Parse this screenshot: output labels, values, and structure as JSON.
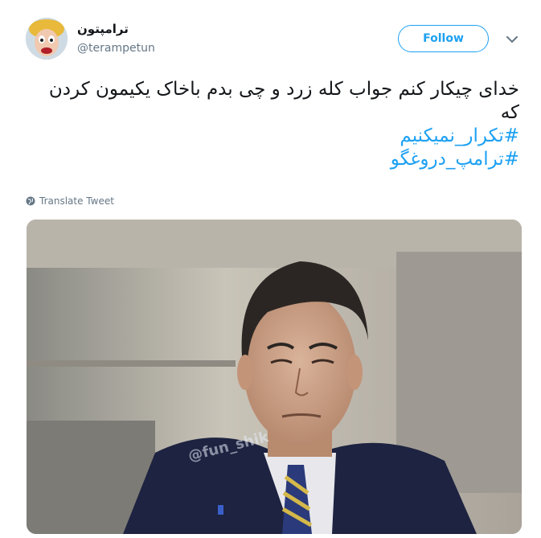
{
  "author": {
    "display_name": "ترامپتون",
    "handle": "@terampetun"
  },
  "actions": {
    "follow_label": "Follow",
    "menu_icon": "chevron-down-icon"
  },
  "tweet": {
    "text": "خدای چیکار کنم جواب کله زرد و چی بدم باخاک یکیمون کردن که",
    "hashtags": [
      "#تکرار_نمیکنیم",
      "#ترامپ_دروغگو"
    ]
  },
  "translate_label": "Translate Tweet",
  "media": {
    "watermark": "@fun_shik"
  },
  "colors": {
    "accent": "#1da1f2",
    "secondary_text": "#657786"
  }
}
